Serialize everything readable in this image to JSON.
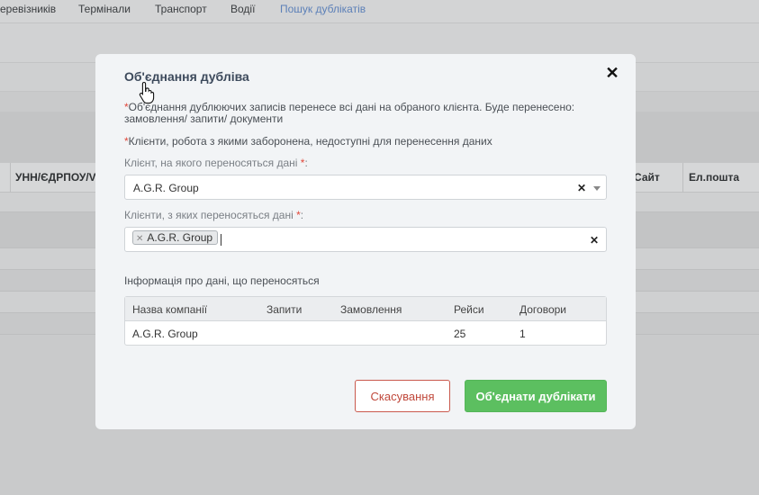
{
  "background": {
    "nav_items": [
      {
        "label": "еревізників",
        "active": false
      },
      {
        "label": "Термінали",
        "active": false
      },
      {
        "label": "Транспорт",
        "active": false
      },
      {
        "label": "Водії",
        "active": false
      },
      {
        "label": "Пошук дублікатів",
        "active": true
      }
    ],
    "columns": [
      "УНН/ЄДРПОУ/V",
      "Сайт",
      "Ел.пошта"
    ]
  },
  "modal": {
    "title": "Об'єднання дубліва",
    "note1": "Об'єднання дублюючих записів перенесе всі дані на обраного клієнта. Буде перенесено: замовлення/ запити/ документи",
    "note2": "Клієнти, робота з якими заборонена, недоступні для перенесення даних",
    "target_label": "Клієнт, на якого переносяться дані",
    "target_value": "A.G.R. Group",
    "source_label": "Клієнти, з яких переносяться дані",
    "source_tags": [
      "A.G.R. Group"
    ],
    "required_mark": "*",
    "info_title": "Інформація про дані, що переносяться",
    "table": {
      "headers": [
        "Назва компанії",
        "Запити",
        "Замовлення",
        "Рейси",
        "Договори"
      ],
      "rows": [
        [
          "A.G.R. Group",
          "",
          "",
          "25",
          "1"
        ]
      ]
    },
    "cancel_label": "Скасування",
    "merge_label": "Об'єднати дублікати"
  },
  "icons": {
    "close": "close-icon",
    "clear": "clear-icon",
    "dropdown": "chevron-down-icon",
    "cursor": "hand-pointer-icon"
  },
  "colors": {
    "accent_green": "#5cbf60",
    "cancel_red": "#c0483b",
    "required": "#e0473a",
    "link_active": "#5c80b8"
  }
}
